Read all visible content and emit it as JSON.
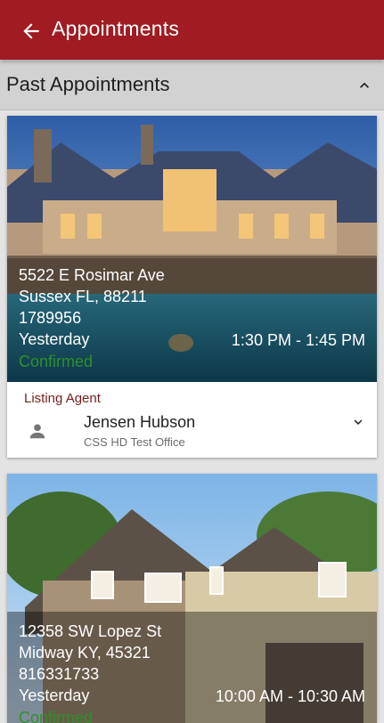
{
  "appbar": {
    "title": "Appointments",
    "icon": "arrow-back-icon"
  },
  "section": {
    "label": "Past Appointments",
    "icon": "chevron-up-icon"
  },
  "appointments": [
    {
      "street": "5522 E Rosimar Ave",
      "city": "Sussex FL, 88211",
      "id": "1789956",
      "day": "Yesterday",
      "time": "1:30 PM - 1:45 PM",
      "status": "Confirmed",
      "agent_label": "Listing Agent",
      "agent_name": "Jensen Hubson",
      "agent_office": "CSS HD Test Office"
    },
    {
      "street": "12358 SW Lopez St",
      "city": "Midway KY, 45321",
      "id": "816331733",
      "day": "Yesterday",
      "time": "10:00 AM - 10:30 AM",
      "status": "Confirmed"
    }
  ],
  "colors": {
    "appbar": "#a01c22",
    "status_confirmed": "#2f8f2f",
    "agent_label": "#7b1c1c"
  }
}
